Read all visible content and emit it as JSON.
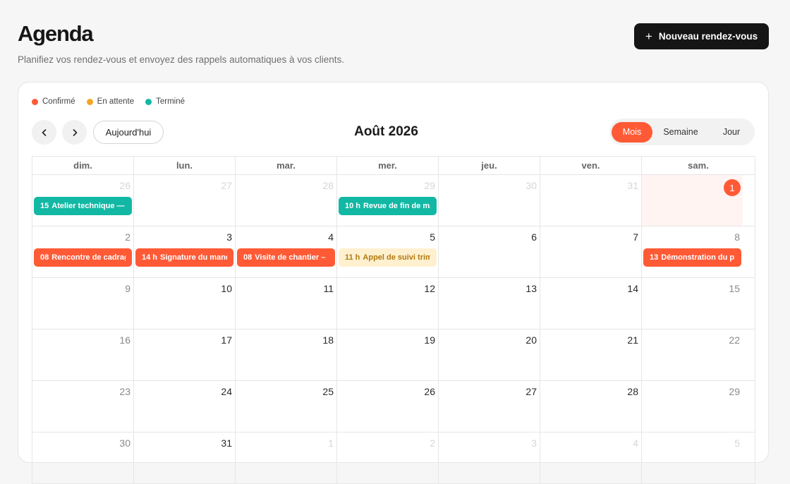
{
  "header": {
    "title": "Agenda",
    "subtitle": "Planifiez vos rendez-vous et envoyez des rappels automatiques à vos clients.",
    "new_button_label": "Nouveau rendez-vous"
  },
  "legend": [
    {
      "label": "Confirmé",
      "color": "#ff5a36"
    },
    {
      "label": "En attente",
      "color": "#f5a623"
    },
    {
      "label": "Terminé",
      "color": "#12b8a4"
    }
  ],
  "toolbar": {
    "today_label": "Aujourd'hui",
    "month_title": "Août 2026",
    "views": [
      "Mois",
      "Semaine",
      "Jour"
    ],
    "active_view": "Mois"
  },
  "weekdays": [
    "dim.",
    "lun.",
    "mar.",
    "mer.",
    "jeu.",
    "ven.",
    "sam."
  ],
  "weeks": [
    [
      "26",
      "27",
      "28",
      "29",
      "30",
      "31",
      "1"
    ],
    [
      "2",
      "3",
      "4",
      "5",
      "6",
      "7",
      "8"
    ],
    [
      "9",
      "10",
      "11",
      "12",
      "13",
      "14",
      "15"
    ],
    [
      "16",
      "17",
      "18",
      "19",
      "20",
      "21",
      "22"
    ],
    [
      "23",
      "24",
      "25",
      "26",
      "27",
      "28",
      "29"
    ],
    [
      "30",
      "31",
      "1",
      "2",
      "3",
      "4",
      "5"
    ]
  ],
  "events": {
    "w0d0": {
      "time": "15",
      "label": "Atelier technique —",
      "status": "done"
    },
    "w0d3": {
      "time": "10 h",
      "label": "Revue de fin de ma",
      "status": "done"
    },
    "w1d0": {
      "time": "08",
      "label": "Rencontre de cadrag",
      "status": "confirmed"
    },
    "w1d1": {
      "time": "14 h",
      "label": "Signature du mand",
      "status": "confirmed"
    },
    "w1d2": {
      "time": "08",
      "label": "Visite de chantier –",
      "status": "confirmed"
    },
    "w1d3": {
      "time": "11 h",
      "label": "Appel de suivi trime",
      "status": "pending"
    },
    "w1d6": {
      "time": "13",
      "label": "Démonstration du p",
      "status": "confirmed"
    }
  }
}
